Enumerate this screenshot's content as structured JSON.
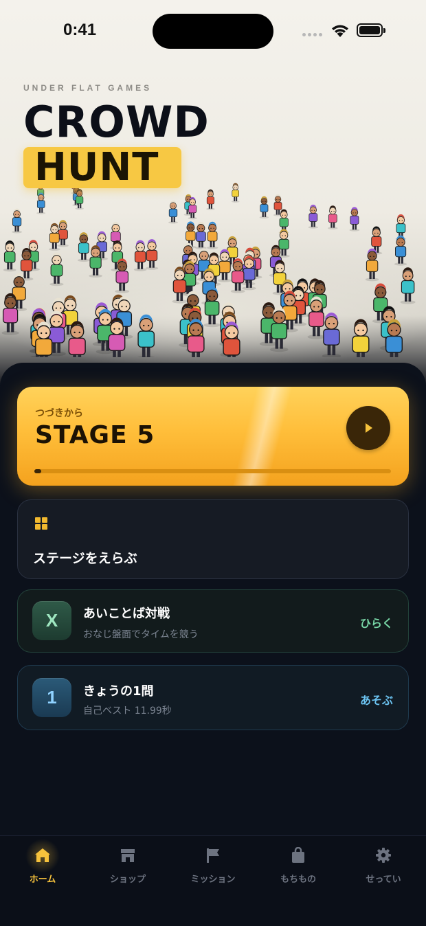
{
  "status_bar": {
    "time": "0:41"
  },
  "hero": {
    "studio": "UNDER FLAT GAMES",
    "title_line1": "CROWD",
    "title_line2": "HUNT"
  },
  "continue_card": {
    "subtitle": "つづきから",
    "stage_label": "STAGE 5",
    "progress": 0.02,
    "play_icon": "play-icon"
  },
  "stage_select": {
    "icon": "grid-icon",
    "label": "ステージをえらぶ"
  },
  "versus": {
    "badge": "X",
    "title": "あいことば対戦",
    "subtitle": "おなじ盤面でタイムを競う",
    "action": "ひらく"
  },
  "daily": {
    "badge": "1",
    "title": "きょうの1問",
    "subtitle": "自己ベスト 11.99秒",
    "action": "あそぶ"
  },
  "tabs": [
    {
      "label": "ホーム",
      "icon": "home-icon",
      "active": true
    },
    {
      "label": "ショップ",
      "icon": "shop-icon",
      "active": false
    },
    {
      "label": "ミッション",
      "icon": "flag-icon",
      "active": false
    },
    {
      "label": "もちもの",
      "icon": "bag-icon",
      "active": false
    },
    {
      "label": "せってい",
      "icon": "gear-icon",
      "active": false
    }
  ],
  "colors": {
    "accent": "#f6c23c",
    "panel": "#0c111b",
    "versus_accent": "#78d6a6",
    "daily_accent": "#6cc4f2"
  }
}
